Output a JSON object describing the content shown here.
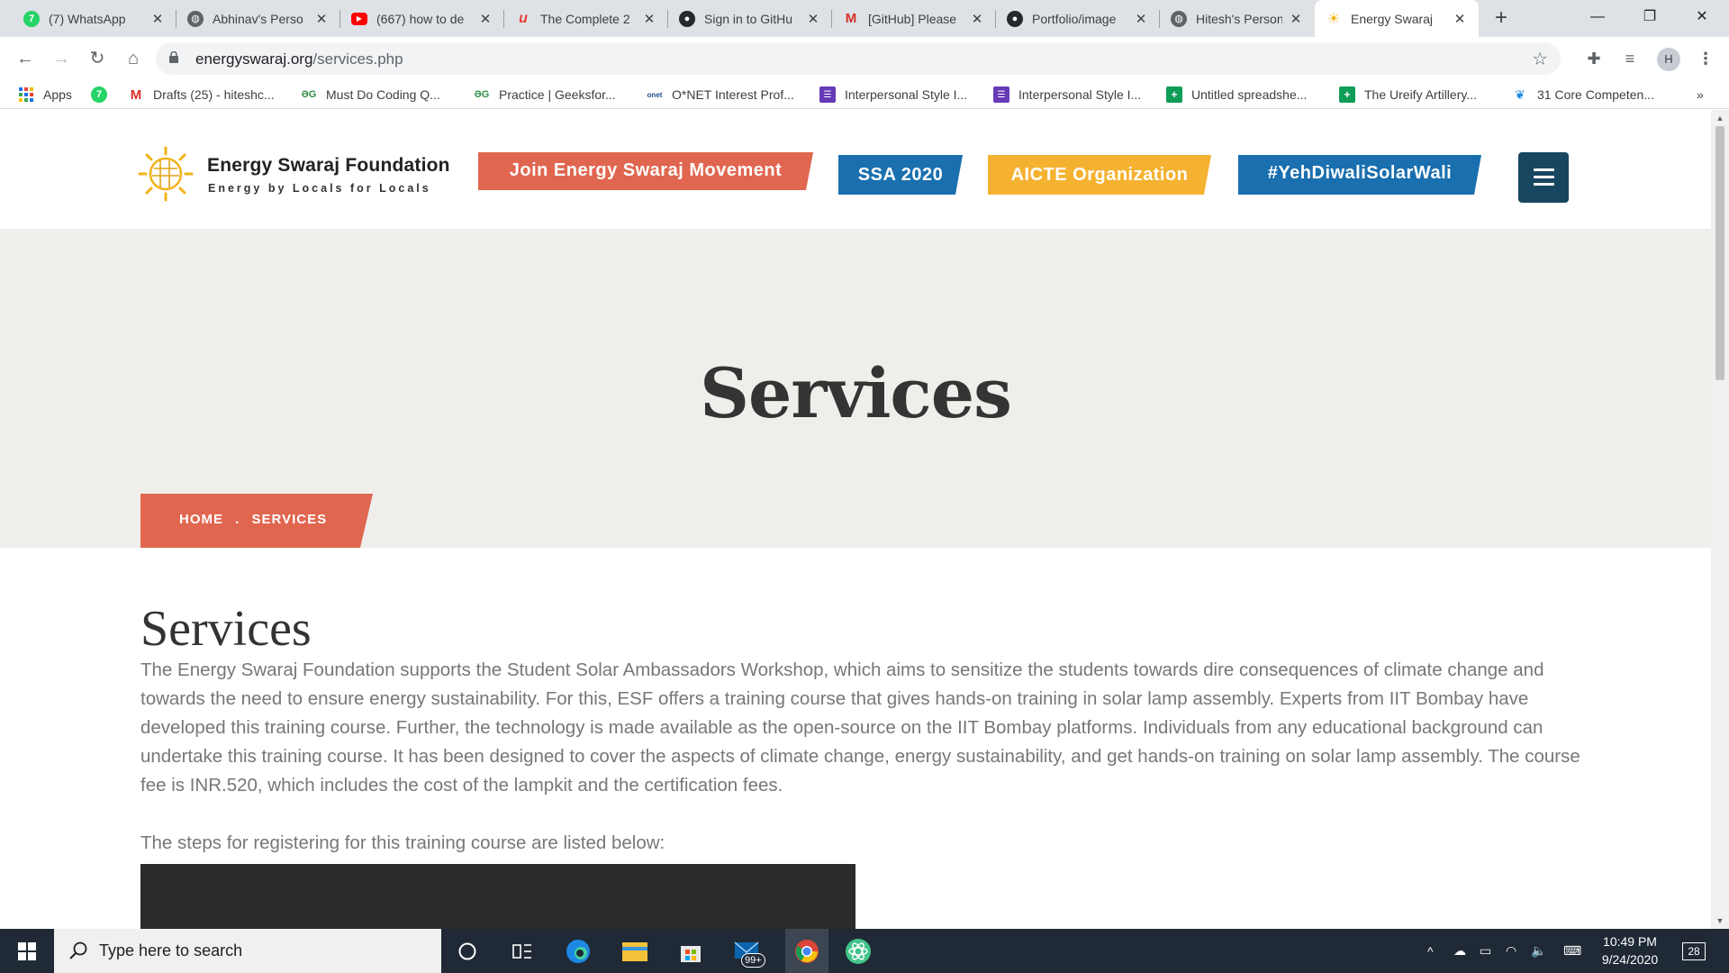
{
  "browser": {
    "tabs": [
      {
        "title": "(7) WhatsApp",
        "icon": "whatsapp-icon",
        "color": "#25d366",
        "badge": "7"
      },
      {
        "title": "Abhinav's Perso",
        "icon": "globe-icon",
        "color": "#5f6368"
      },
      {
        "title": "(667) how to de",
        "icon": "youtube-icon",
        "color": "#ff0000"
      },
      {
        "title": "The Complete 2",
        "icon": "udemy-icon",
        "color": "#e83e35"
      },
      {
        "title": "Sign in to GitHu",
        "icon": "github-icon",
        "color": "#24292e"
      },
      {
        "title": "[GitHub] Please",
        "icon": "gmail-icon",
        "color": "#d93025"
      },
      {
        "title": "Portfolio/image",
        "icon": "github-icon",
        "color": "#24292e"
      },
      {
        "title": "Hitesh's Person",
        "icon": "globe-icon",
        "color": "#5f6368"
      },
      {
        "title": "Energy Swaraj",
        "icon": "energy-swaraj-favicon",
        "color": "#f2b21a",
        "active": true
      }
    ],
    "url_host": "energyswaraj.org",
    "url_path": "/services.php",
    "profile_initial": "H",
    "bookmarks": [
      {
        "label": "Apps",
        "icon": "apps-grid-icon"
      },
      {
        "label": "",
        "icon": "whatsapp-icon"
      },
      {
        "label": "Drafts (25) - hiteshc...",
        "icon": "gmail-icon"
      },
      {
        "label": "Must Do Coding Q...",
        "icon": "geeksforgeeks-icon"
      },
      {
        "label": "Practice | Geeksfor...",
        "icon": "geeksforgeeks-icon"
      },
      {
        "label": "O*NET Interest Prof...",
        "icon": "onet-icon"
      },
      {
        "label": "Interpersonal Style I...",
        "icon": "forms-icon"
      },
      {
        "label": "Interpersonal Style I...",
        "icon": "forms-icon"
      },
      {
        "label": "Untitled spreadshe...",
        "icon": "sheets-icon"
      },
      {
        "label": "The Ureify Artillery...",
        "icon": "sheets-icon"
      },
      {
        "label": "31 Core Competen...",
        "icon": "core-competencies-icon"
      }
    ],
    "more_bookmarks": "»"
  },
  "site": {
    "logo_name": "Energy Swaraj Foundation",
    "logo_tagline": "Energy by Locals for Locals",
    "nav_buttons": [
      {
        "label": "Join Energy Swaraj Movement",
        "color": "#e06650"
      },
      {
        "label": "SSA 2020",
        "color": "#1a6fae"
      },
      {
        "label": "AICTE Organization",
        "color": "#f5b231"
      },
      {
        "label": "#YehDiwaliSolarWali",
        "color": "#1a6fae"
      }
    ],
    "hero_title": "Services",
    "breadcrumb": {
      "home": "HOME",
      "separator": ".",
      "current": "SERVICES"
    },
    "content": {
      "heading": "Services",
      "paragraph": "The Energy Swaraj Foundation supports the Student Solar Ambassadors Workshop, which aims to sensitize the students towards dire consequences of climate change and towards the need to ensure energy sustainability. For this, ESF offers a training course that gives hands-on training in solar lamp assembly. Experts from IIT Bombay have developed this training course. Further, the technology is made available as the open-source on the IIT Bombay platforms. Individuals from any educational background can undertake this training course. It has been designed to cover the aspects of climate change, energy sustainability, and get hands-on training on solar lamp assembly. The course fee is INR.520, which includes the cost of the lampkit and the certification fees.",
      "steps_intro": "The steps for registering for this training course are listed below:"
    },
    "colors": {
      "accent_red": "#e06650",
      "accent_blue": "#1a6fae",
      "accent_yellow": "#f5b231",
      "menu_dark": "#184660"
    }
  },
  "taskbar": {
    "search_placeholder": "Type here to search",
    "mail_badge": "99+",
    "time": "10:49 PM",
    "date": "9/24/2020",
    "notification_count": "28"
  }
}
